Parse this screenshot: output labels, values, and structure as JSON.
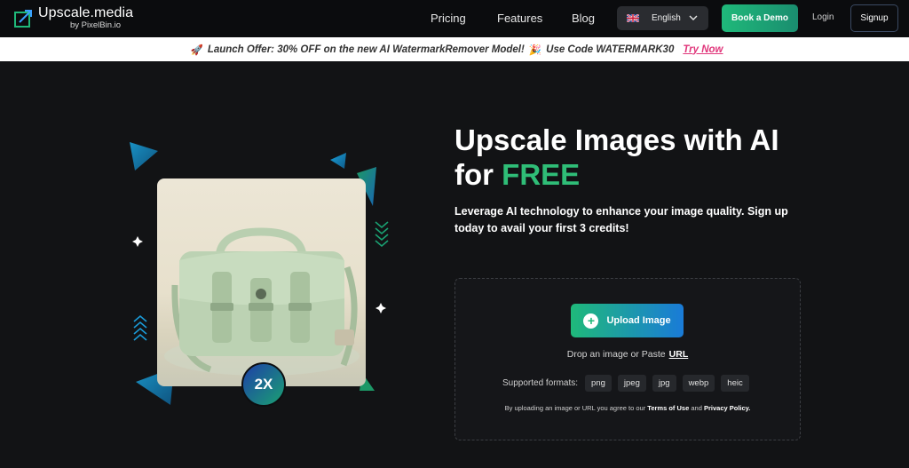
{
  "nav": {
    "logo_name": "Upscale.media",
    "logo_sub": "by PixelBin.io",
    "links": [
      "Pricing",
      "Features",
      "Blog"
    ],
    "language": "English",
    "book_demo": "Book a Demo",
    "login": "Login",
    "signup": "Signup"
  },
  "banner": {
    "text": "Launch Offer: 30% OFF on the new AI WatermarkRemover Model!",
    "code_text": "Use Code WATERMARK30",
    "try_now": "Try Now"
  },
  "hero": {
    "title_line1": "Upscale Images with AI",
    "title_for": "for",
    "title_free": "FREE",
    "subtitle": "Leverage AI technology to enhance your image quality. Sign up today to avail your first 3 credits!",
    "badge": "2X"
  },
  "upload": {
    "button": "Upload Image",
    "drop_text": "Drop an image or Paste",
    "url_link": "URL",
    "formats_label": "Supported formats:",
    "formats": [
      "png",
      "jpeg",
      "jpg",
      "webp",
      "heic"
    ],
    "legal_prefix": "By uploading an image or URL you agree to our",
    "terms": "Terms of Use",
    "and": "and",
    "privacy": "Privacy Policy."
  },
  "colors": {
    "accent_green": "#2fbd77",
    "accent_blue": "#1a7bd8",
    "promo_pink": "#e0357a",
    "background": "#121315"
  }
}
